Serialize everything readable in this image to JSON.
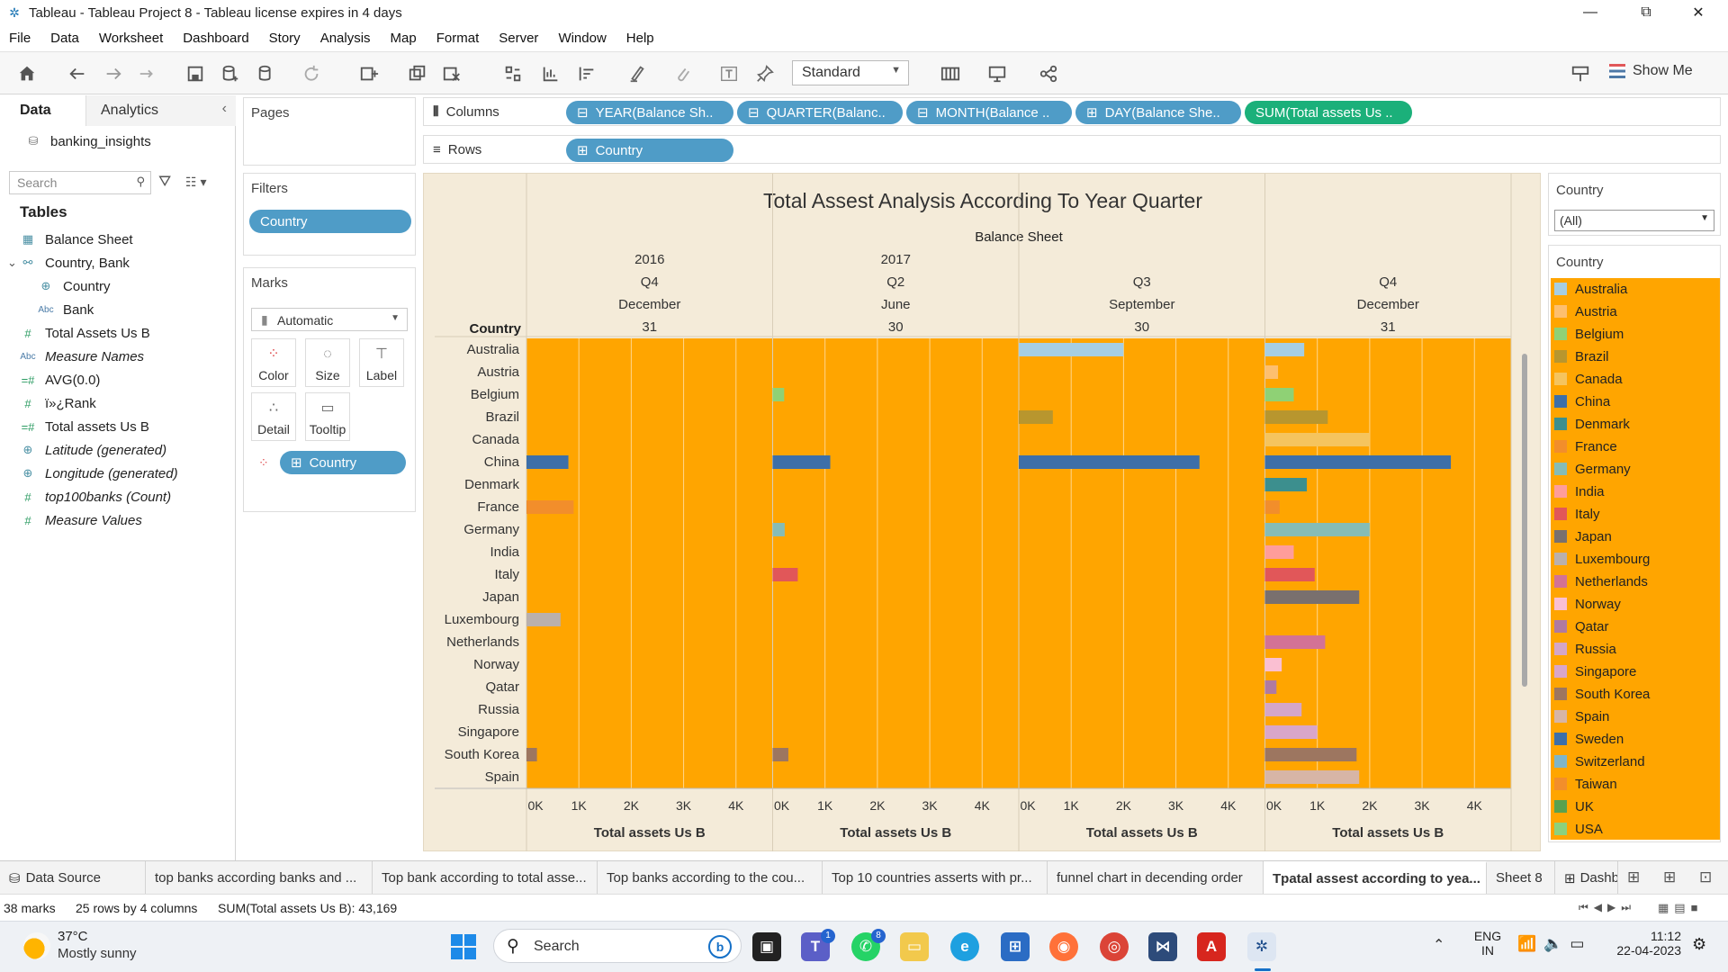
{
  "window": {
    "title": "Tableau - Tableau Project 8 - Tableau license expires in 4 days",
    "min": "—",
    "restore": "⧉",
    "close": "✕"
  },
  "menu": [
    "File",
    "Data",
    "Worksheet",
    "Dashboard",
    "Story",
    "Analysis",
    "Map",
    "Format",
    "Server",
    "Window",
    "Help"
  ],
  "toolbar": {
    "fit_select": "Standard",
    "show_me": "Show Me"
  },
  "left_pane": {
    "tab_data": "Data",
    "tab_analytics": "Analytics",
    "datasource": "banking_insights",
    "search_placeholder": "Search",
    "tables_heading": "Tables",
    "fields": [
      {
        "label": "Balance Sheet",
        "icon": "calendar-icon",
        "indent": 0,
        "italic": false
      },
      {
        "label": "Country, Bank",
        "icon": "hierarchy-icon",
        "indent": 0,
        "italic": false
      },
      {
        "label": "Country",
        "icon": "globe-icon",
        "indent": 1,
        "italic": false
      },
      {
        "label": "Bank",
        "icon": "abc-icon",
        "indent": 1,
        "italic": false
      },
      {
        "label": "Total Assets Us B",
        "icon": "hash-icon",
        "indent": 0,
        "italic": false
      },
      {
        "label": "Measure Names",
        "icon": "abc-icon",
        "indent": 0,
        "italic": true
      },
      {
        "label": "AVG(0.0)",
        "icon": "calc-hash-icon",
        "indent": 0,
        "italic": false
      },
      {
        "label": "ï»¿Rank",
        "icon": "hash-icon",
        "indent": 0,
        "italic": false
      },
      {
        "label": "Total assets Us B",
        "icon": "calc-hash-icon",
        "indent": 0,
        "italic": false
      },
      {
        "label": "Latitude (generated)",
        "icon": "globe-icon",
        "indent": 0,
        "italic": true
      },
      {
        "label": "Longitude (generated)",
        "icon": "globe-icon",
        "indent": 0,
        "italic": true
      },
      {
        "label": "top100banks (Count)",
        "icon": "hash-icon",
        "indent": 0,
        "italic": true
      },
      {
        "label": "Measure Values",
        "icon": "hash-icon",
        "indent": 0,
        "italic": true
      }
    ]
  },
  "cards": {
    "pages": "Pages",
    "filters": "Filters",
    "filter_pill": "Country",
    "marks": "Marks",
    "mark_type": "Automatic",
    "mark_buttons": [
      "Color",
      "Size",
      "Label",
      "Detail",
      "Tooltip"
    ],
    "marks_pill": "Country"
  },
  "shelves": {
    "columns_label": "Columns",
    "rows_label": "Rows",
    "columns_pills": [
      "YEAR(Balance Sh..",
      "QUARTER(Balanc..",
      "MONTH(Balance ..",
      "DAY(Balance She..",
      "SUM(Total assets Us .."
    ],
    "rows_pill": "Country"
  },
  "colors": {
    "background_viz": "#f4ebd9",
    "bar_background": "#ffa500",
    "pill_blue": "#4f9cc7",
    "pill_green": "#1bb07a"
  },
  "chart_data": {
    "type": "bar",
    "title": "Total Assest Analysis According To Year Quarter",
    "header_field": "Balance Sheet",
    "row_header": "Country",
    "xlabel": "Total assets Us B",
    "xlim": [
      0,
      4700
    ],
    "ticks": [
      "0K",
      "1K",
      "2K",
      "3K",
      "4K"
    ],
    "panes": [
      {
        "year": "2016",
        "quarter": "Q4",
        "month": "December",
        "day": "31"
      },
      {
        "year": "2017",
        "quarter": "Q2",
        "month": "June",
        "day": "30"
      },
      {
        "year": "",
        "quarter": "Q3",
        "month": "September",
        "day": "30"
      },
      {
        "year": "",
        "quarter": "Q4",
        "month": "December",
        "day": "31"
      }
    ],
    "categories": [
      "Australia",
      "Austria",
      "Belgium",
      "Brazil",
      "Canada",
      "China",
      "Denmark",
      "France",
      "Germany",
      "India",
      "Italy",
      "Japan",
      "Luxembourg",
      "Netherlands",
      "Norway",
      "Qatar",
      "Russia",
      "Singapore",
      "South Korea",
      "Spain"
    ],
    "category_colors": {
      "Australia": "#a6cee3",
      "Austria": "#fdbf6f",
      "Belgium": "#8fd175",
      "Brazil": "#b8962e",
      "Canada": "#f5c45e",
      "China": "#3d6fa8",
      "Denmark": "#3c8f8e",
      "France": "#f28e2b",
      "Germany": "#86bcb6",
      "India": "#ff9d9a",
      "Italy": "#e15759",
      "Japan": "#79706e",
      "Luxembourg": "#bab0ac",
      "Netherlands": "#d37295",
      "Norway": "#fabfd2",
      "Qatar": "#b07aa1",
      "Russia": "#d4a6c8",
      "Singapore": "#d9a6c9",
      "South Korea": "#9d7660",
      "Spain": "#d7b5a6"
    },
    "series": [
      {
        "values": [
          null,
          null,
          null,
          null,
          null,
          800,
          null,
          900,
          null,
          null,
          null,
          null,
          650,
          null,
          null,
          null,
          null,
          null,
          200,
          null
        ]
      },
      {
        "values": [
          null,
          null,
          220,
          null,
          null,
          1100,
          null,
          null,
          230,
          null,
          480,
          null,
          null,
          null,
          null,
          null,
          null,
          null,
          300,
          null
        ]
      },
      {
        "values": [
          2000,
          null,
          null,
          650,
          null,
          3450,
          null,
          null,
          null,
          null,
          null,
          null,
          null,
          null,
          null,
          null,
          null,
          null,
          null,
          null
        ]
      },
      {
        "values": [
          750,
          250,
          550,
          1200,
          2000,
          3550,
          800,
          280,
          2000,
          550,
          950,
          1800,
          null,
          1150,
          320,
          220,
          700,
          1000,
          1750,
          1800
        ]
      }
    ]
  },
  "legend": {
    "filter_title": "Country",
    "filter_value": "(All)",
    "legend_title": "Country",
    "items": [
      {
        "name": "Australia",
        "color": "#a6cee3"
      },
      {
        "name": "Austria",
        "color": "#fdbf6f"
      },
      {
        "name": "Belgium",
        "color": "#8fd175"
      },
      {
        "name": "Brazil",
        "color": "#b8962e"
      },
      {
        "name": "Canada",
        "color": "#f5c45e"
      },
      {
        "name": "China",
        "color": "#3d6fa8"
      },
      {
        "name": "Denmark",
        "color": "#3c8f8e"
      },
      {
        "name": "France",
        "color": "#f28e2b"
      },
      {
        "name": "Germany",
        "color": "#86bcb6"
      },
      {
        "name": "India",
        "color": "#ff9d9a"
      },
      {
        "name": "Italy",
        "color": "#e15759"
      },
      {
        "name": "Japan",
        "color": "#79706e"
      },
      {
        "name": "Luxembourg",
        "color": "#bab0ac"
      },
      {
        "name": "Netherlands",
        "color": "#d37295"
      },
      {
        "name": "Norway",
        "color": "#fabfd2"
      },
      {
        "name": "Qatar",
        "color": "#b07aa1"
      },
      {
        "name": "Russia",
        "color": "#d4a6c8"
      },
      {
        "name": "Singapore",
        "color": "#d9a6c9"
      },
      {
        "name": "South Korea",
        "color": "#9d7660"
      },
      {
        "name": "Spain",
        "color": "#d7b5a6"
      },
      {
        "name": "Sweden",
        "color": "#3d6fa8"
      },
      {
        "name": "Switzerland",
        "color": "#7fb5c8"
      },
      {
        "name": "Taiwan",
        "color": "#f28e2b"
      },
      {
        "name": "UK",
        "color": "#59a14f"
      },
      {
        "name": "USA",
        "color": "#8cd17d"
      }
    ]
  },
  "sheet_tabs": [
    {
      "label": "Data Source",
      "active": false
    },
    {
      "label": "top banks according banks and ...",
      "active": false
    },
    {
      "label": "Top bank according to total asse...",
      "active": false
    },
    {
      "label": "Top banks according to the cou...",
      "active": false
    },
    {
      "label": "Top 10 countries asserts with pr...",
      "active": false
    },
    {
      "label": "funnel chart in decending order",
      "active": false
    },
    {
      "label": "Tpatal assest according to yea...",
      "active": true
    },
    {
      "label": "Sheet 8",
      "active": false
    },
    {
      "label": "Dashb",
      "active": false
    }
  ],
  "status": {
    "marks": "38 marks",
    "dims": "25 rows by 4 columns",
    "sum": "SUM(Total assets Us B): 43,169"
  },
  "taskbar": {
    "weather_temp": "37°C",
    "weather_desc": "Mostly sunny",
    "search": "Search",
    "lang1": "ENG",
    "lang2": "IN",
    "time": "11:12",
    "date": "22-04-2023",
    "badge_teams": "1",
    "badge_whatsapp": "8"
  }
}
